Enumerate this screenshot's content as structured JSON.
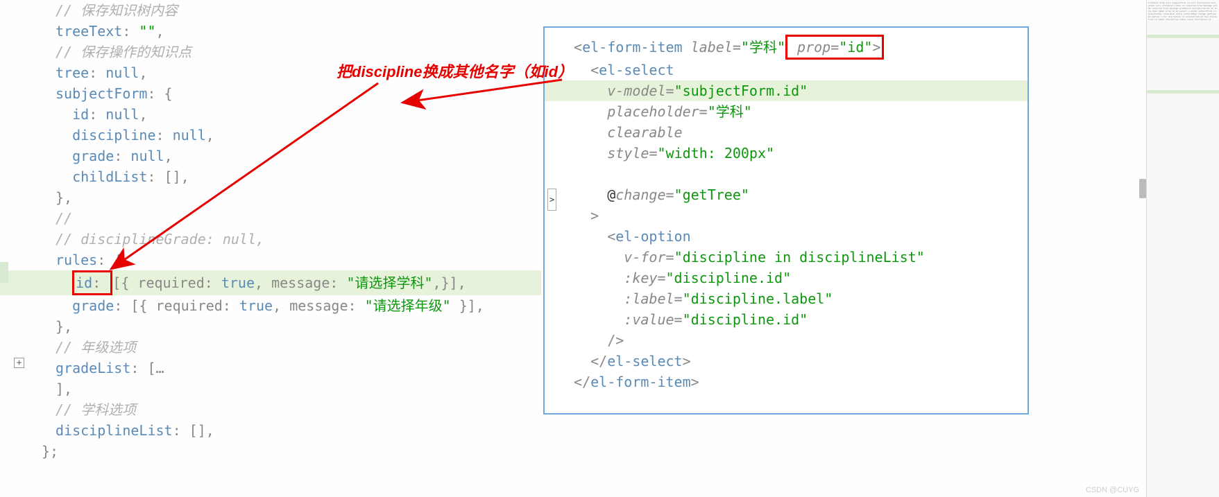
{
  "annotation": {
    "text": "把discipline换成其他名字（如id）"
  },
  "left_code": {
    "l1": "// 保存知识树内容",
    "l2_key": "treeText",
    "l2_val": "\"\"",
    "l3": "// 保存操作的知识点",
    "l4_key": "tree",
    "l4_val": "null",
    "l5_key": "subjectForm",
    "l6_key": "id",
    "l6_val": "null",
    "l7_key": "discipline",
    "l7_val": "null",
    "l8_key": "grade",
    "l8_val": "null",
    "l9_key": "childList",
    "l9_val": "[]",
    "l11": "//",
    "l12": "// disciplineGrade: null,",
    "l13_key": "rules",
    "l14_key": "id",
    "l14_rest": "[{ required: true, message: \"请选择学科\",}],",
    "l14_true": "true",
    "l14_msg": "\"请选择学科\"",
    "l15_key": "grade",
    "l15_true": "true",
    "l15_msg": "\"请选择年级\"",
    "l17": "// 年级选项",
    "l18_key": "gradeList",
    "l20": "// 学科选项",
    "l21_key": "disciplineList",
    "l21_val": "[]"
  },
  "right_code": {
    "r1_tag": "el-form-item",
    "r1_attr1": "label",
    "r1_val1": "\"学科\"",
    "r1_attr2": "prop",
    "r1_val2": "\"id\"",
    "r2_tag": "el-select",
    "r3_attr": "v-model",
    "r3_val": "\"subjectForm.id\"",
    "r4_attr": "placeholder",
    "r4_val": "\"学科\"",
    "r5_attr": "clearable",
    "r6_attr": "style",
    "r6_val": "\"width: 200px\"",
    "r8_attr": "@change",
    "r8_val": "\"getTree\"",
    "r10_tag": "el-option",
    "r11_attr": "v-for",
    "r11_val": "\"discipline in disciplineList\"",
    "r12_attr": ":key",
    "r12_val": "\"discipline.id\"",
    "r13_attr": ":label",
    "r13_val": "\"discipline.label\"",
    "r14_attr": ":value",
    "r14_val": "\"discipline.id\"",
    "r16_tag": "el-select",
    "r17_tag": "el-form-item"
  },
  "watermark": "CSDN @CUYG"
}
